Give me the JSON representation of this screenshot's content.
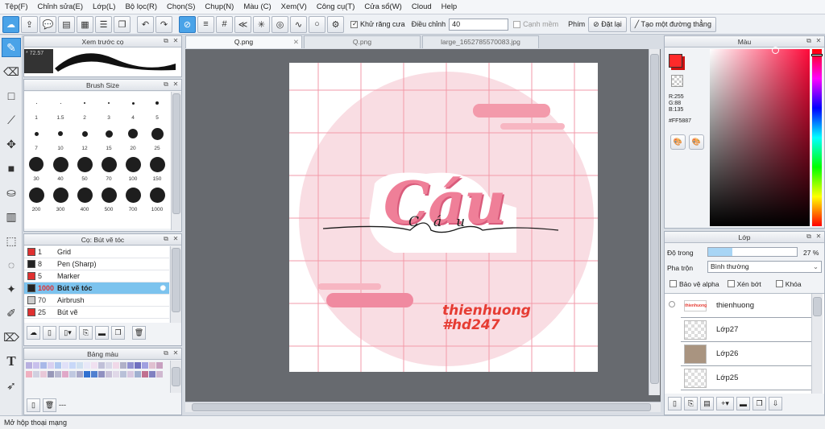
{
  "menu": [
    "Tệp(F)",
    "Chỉnh sửa(E)",
    "Lớp(L)",
    "Bộ lọc(R)",
    "Chọn(S)",
    "Chụp(N)",
    "Màu (C)",
    "Xem(V)",
    "Công cụ(T)",
    "Cửa sổ(W)",
    "Cloud",
    "Help"
  ],
  "toolbar": {
    "antialias_label": "Khử răng cưa",
    "correction_label": "Điều chỉnh",
    "correction_value": "40",
    "smooth_label": "Cạnh mềm",
    "keys_label": "Phím",
    "reset_label": "Đặt lại",
    "line_label": "Tạo một đường thẳng"
  },
  "brush_preview": {
    "title": "Xem trước cọ",
    "size_text": "* 72.57"
  },
  "brush_size": {
    "title": "Brush Size",
    "sizes": [
      "1",
      "1.5",
      "2",
      "3",
      "4",
      "5",
      "7",
      "10",
      "12",
      "15",
      "20",
      "25",
      "30",
      "40",
      "50",
      "70",
      "100",
      "150",
      "200",
      "300",
      "400",
      "500",
      "700",
      "1000"
    ]
  },
  "brush_list": {
    "title": "Cọ: Bút vẽ tóc",
    "items": [
      {
        "num": "1",
        "name": "Grid",
        "color": "#e03030"
      },
      {
        "num": "8",
        "name": "Pen (Sharp)",
        "color": "#222222"
      },
      {
        "num": "5",
        "name": "Marker",
        "color": "#e03030"
      },
      {
        "num": "1000",
        "name": "Bút vẽ tóc",
        "color": "#222222",
        "selected": true
      },
      {
        "num": "70",
        "name": "Airbrush",
        "color": "#cccccc"
      },
      {
        "num": "25",
        "name": "Bút vẽ",
        "color": "#e03030"
      }
    ]
  },
  "palette": {
    "title": "Bảng màu",
    "footer_text": "---",
    "swatches": [
      "#b8b0e0",
      "#c8c0ec",
      "#a8b8e8",
      "#d8d0f0",
      "#b0c8f0",
      "#e0e0f8",
      "#c8d8f8",
      "#d0e0f0",
      "#e8e8f8",
      "#f0e0f0",
      "#c0c0d8",
      "#d8d8e8",
      "#f0d8e8",
      "#b0b0c8",
      "#9090d0",
      "#7070c0",
      "#a0a0e0",
      "#e0c0d0",
      "#c8a0c0",
      "#f0b0c0",
      "#d0d0e0",
      "#e8c8d8",
      "#9898b8",
      "#b8b8d0",
      "#e0a8c8",
      "#c0c8e0",
      "#a8a8c8",
      "#3070d0",
      "#5080d0",
      "#9090c0",
      "#c8c0d8",
      "#e0d8e8",
      "#b8c0d8",
      "#d8c8e0",
      "#a0b0d0",
      "#c07090",
      "#8080c0",
      "#d0b8d0"
    ]
  },
  "tabs": [
    {
      "label": "Q.png",
      "active": true
    },
    {
      "label": "Q.png",
      "active": false
    },
    {
      "label": "large_1652785570083.jpg",
      "active": false
    }
  ],
  "canvas": {
    "big_text": "Cáu",
    "script_text": "Cáu",
    "signature_line1": "thienhuong",
    "signature_line2": "#hd247"
  },
  "color_panel": {
    "title": "Màu",
    "r": "R:255",
    "g": "G:88",
    "b": "B:135",
    "hex": "#FF5887",
    "main_color": "#ff2a2a"
  },
  "layers": {
    "title": "Lớp",
    "opacity_label": "Độ trong",
    "opacity_value": "27 %",
    "opacity_fraction": 0.27,
    "blend_label": "Pha trộn",
    "blend_value": "Bình thường",
    "protect_alpha": "Bảo vệ alpha",
    "clipping": "Xén bớt",
    "lock": "Khóa",
    "items": [
      "thienhuong",
      "Lớp27",
      "Lớp26",
      "Lớp25"
    ]
  },
  "status": "Mở hộp thoại mạng"
}
